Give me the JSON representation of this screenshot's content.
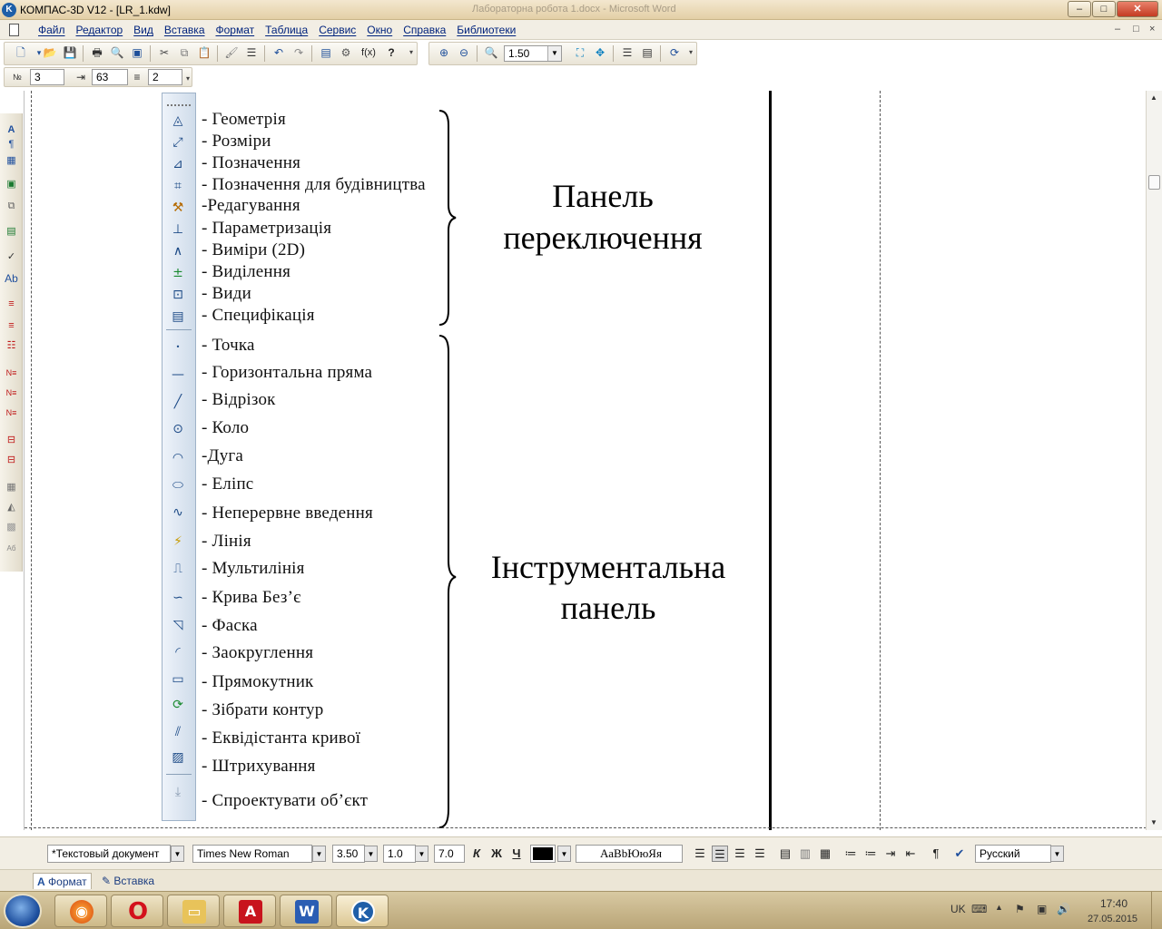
{
  "window": {
    "title": "КОМПАС-3D V12 - [LR_1.kdw]",
    "background_title": "Лабораторна робота 1.docx - Microsoft Word",
    "minimize": "–",
    "maximize": "□",
    "close": "✕"
  },
  "menu": {
    "items": [
      "Файл",
      "Редактор",
      "Вид",
      "Вставка",
      "Формат",
      "Таблица",
      "Сервис",
      "Окно",
      "Справка",
      "Библиотеки"
    ],
    "mdi_controls": [
      "–",
      "□",
      "×"
    ]
  },
  "main_toolbar": {
    "zoom_value": "1.50",
    "fx_label": "f(x)"
  },
  "table_toolbar": {
    "field1": "3",
    "field2": "63",
    "field3": "2"
  },
  "figure": {
    "switch_panel_items": [
      "- Геометрія",
      "- Розміри",
      "- Позначення",
      "- Позначення для будівництва",
      "-Редагування",
      "- Параметризація",
      "- Виміри (2D)",
      "- Виділення",
      "- Види",
      "- Специфікація"
    ],
    "instrument_panel_items": [
      "- Точка",
      "- Горизонтальна пряма",
      "- Відрізок",
      "- Коло",
      "-Дуга",
      "- Еліпс",
      "- Неперервне введення",
      "- Лінія",
      "- Мультилінія",
      "- Крива Без’є",
      "- Фаска",
      "- Заокруглення",
      "- Прямокутник",
      "- Зібрати контур",
      "- Еквідістанта кривої",
      "- Штрихування",
      "- Спроектувати об’єкт"
    ],
    "switch_panel_label_line1": "Панель",
    "switch_panel_label_line2": "переключення",
    "instrument_panel_label_line1": "Інструментальна",
    "instrument_panel_label_line2": "панель"
  },
  "format_panel": {
    "style": "*Текстовый документ",
    "font": "Times New Roman",
    "size": "3.50",
    "spacing": "1.0",
    "width": "7.0",
    "italic": "К",
    "bold": "Ж",
    "underline": "Ч",
    "sample": "АаBbЮюЯя",
    "language": "Русский",
    "color": "#000000"
  },
  "tabs": {
    "format": "Формат",
    "insert": "Вставка"
  },
  "taskbar": {
    "lang": "UK",
    "time": "17:40",
    "date": "27.05.2015"
  }
}
